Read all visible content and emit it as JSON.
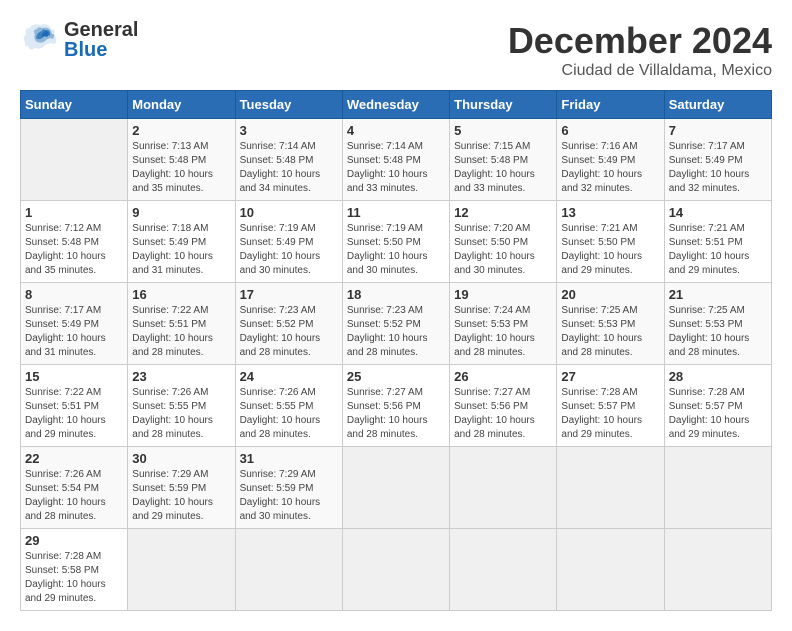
{
  "header": {
    "logo_general": "General",
    "logo_blue": "Blue",
    "title": "December 2024",
    "subtitle": "Ciudad de Villaldama, Mexico"
  },
  "calendar": {
    "days_of_week": [
      "Sunday",
      "Monday",
      "Tuesday",
      "Wednesday",
      "Thursday",
      "Friday",
      "Saturday"
    ],
    "weeks": [
      [
        {
          "day": "",
          "info": ""
        },
        {
          "day": "2",
          "info": "Sunrise: 7:13 AM\nSunset: 5:48 PM\nDaylight: 10 hours\nand 35 minutes."
        },
        {
          "day": "3",
          "info": "Sunrise: 7:14 AM\nSunset: 5:48 PM\nDaylight: 10 hours\nand 34 minutes."
        },
        {
          "day": "4",
          "info": "Sunrise: 7:14 AM\nSunset: 5:48 PM\nDaylight: 10 hours\nand 33 minutes."
        },
        {
          "day": "5",
          "info": "Sunrise: 7:15 AM\nSunset: 5:48 PM\nDaylight: 10 hours\nand 33 minutes."
        },
        {
          "day": "6",
          "info": "Sunrise: 7:16 AM\nSunset: 5:49 PM\nDaylight: 10 hours\nand 32 minutes."
        },
        {
          "day": "7",
          "info": "Sunrise: 7:17 AM\nSunset: 5:49 PM\nDaylight: 10 hours\nand 32 minutes."
        }
      ],
      [
        {
          "day": "1",
          "info": "Sunrise: 7:12 AM\nSunset: 5:48 PM\nDaylight: 10 hours\nand 35 minutes."
        },
        {
          "day": "9",
          "info": "Sunrise: 7:18 AM\nSunset: 5:49 PM\nDaylight: 10 hours\nand 31 minutes."
        },
        {
          "day": "10",
          "info": "Sunrise: 7:19 AM\nSunset: 5:49 PM\nDaylight: 10 hours\nand 30 minutes."
        },
        {
          "day": "11",
          "info": "Sunrise: 7:19 AM\nSunset: 5:50 PM\nDaylight: 10 hours\nand 30 minutes."
        },
        {
          "day": "12",
          "info": "Sunrise: 7:20 AM\nSunset: 5:50 PM\nDaylight: 10 hours\nand 30 minutes."
        },
        {
          "day": "13",
          "info": "Sunrise: 7:21 AM\nSunset: 5:50 PM\nDaylight: 10 hours\nand 29 minutes."
        },
        {
          "day": "14",
          "info": "Sunrise: 7:21 AM\nSunset: 5:51 PM\nDaylight: 10 hours\nand 29 minutes."
        }
      ],
      [
        {
          "day": "8",
          "info": "Sunrise: 7:17 AM\nSunset: 5:49 PM\nDaylight: 10 hours\nand 31 minutes."
        },
        {
          "day": "16",
          "info": "Sunrise: 7:22 AM\nSunset: 5:51 PM\nDaylight: 10 hours\nand 28 minutes."
        },
        {
          "day": "17",
          "info": "Sunrise: 7:23 AM\nSunset: 5:52 PM\nDaylight: 10 hours\nand 28 minutes."
        },
        {
          "day": "18",
          "info": "Sunrise: 7:23 AM\nSunset: 5:52 PM\nDaylight: 10 hours\nand 28 minutes."
        },
        {
          "day": "19",
          "info": "Sunrise: 7:24 AM\nSunset: 5:53 PM\nDaylight: 10 hours\nand 28 minutes."
        },
        {
          "day": "20",
          "info": "Sunrise: 7:25 AM\nSunset: 5:53 PM\nDaylight: 10 hours\nand 28 minutes."
        },
        {
          "day": "21",
          "info": "Sunrise: 7:25 AM\nSunset: 5:53 PM\nDaylight: 10 hours\nand 28 minutes."
        }
      ],
      [
        {
          "day": "15",
          "info": "Sunrise: 7:22 AM\nSunset: 5:51 PM\nDaylight: 10 hours\nand 29 minutes."
        },
        {
          "day": "23",
          "info": "Sunrise: 7:26 AM\nSunset: 5:55 PM\nDaylight: 10 hours\nand 28 minutes."
        },
        {
          "day": "24",
          "info": "Sunrise: 7:26 AM\nSunset: 5:55 PM\nDaylight: 10 hours\nand 28 minutes."
        },
        {
          "day": "25",
          "info": "Sunrise: 7:27 AM\nSunset: 5:56 PM\nDaylight: 10 hours\nand 28 minutes."
        },
        {
          "day": "26",
          "info": "Sunrise: 7:27 AM\nSunset: 5:56 PM\nDaylight: 10 hours\nand 28 minutes."
        },
        {
          "day": "27",
          "info": "Sunrise: 7:28 AM\nSunset: 5:57 PM\nDaylight: 10 hours\nand 29 minutes."
        },
        {
          "day": "28",
          "info": "Sunrise: 7:28 AM\nSunset: 5:57 PM\nDaylight: 10 hours\nand 29 minutes."
        }
      ],
      [
        {
          "day": "22",
          "info": "Sunrise: 7:26 AM\nSunset: 5:54 PM\nDaylight: 10 hours\nand 28 minutes."
        },
        {
          "day": "30",
          "info": "Sunrise: 7:29 AM\nSunset: 5:59 PM\nDaylight: 10 hours\nand 29 minutes."
        },
        {
          "day": "31",
          "info": "Sunrise: 7:29 AM\nSunset: 5:59 PM\nDaylight: 10 hours\nand 30 minutes."
        },
        {
          "day": "",
          "info": ""
        },
        {
          "day": "",
          "info": ""
        },
        {
          "day": "",
          "info": ""
        },
        {
          "day": "",
          "info": ""
        }
      ],
      [
        {
          "day": "29",
          "info": "Sunrise: 7:28 AM\nSunset: 5:58 PM\nDaylight: 10 hours\nand 29 minutes."
        },
        {
          "day": "",
          "info": ""
        },
        {
          "day": "",
          "info": ""
        },
        {
          "day": "",
          "info": ""
        },
        {
          "day": "",
          "info": ""
        },
        {
          "day": "",
          "info": ""
        },
        {
          "day": "",
          "info": ""
        }
      ]
    ],
    "proper_weeks": [
      [
        {
          "day": "1",
          "info": "Sunrise: 7:12 AM\nSunset: 5:48 PM\nDaylight: 10 hours\nand 35 minutes.",
          "empty": false
        },
        {
          "day": "2",
          "info": "Sunrise: 7:13 AM\nSunset: 5:48 PM\nDaylight: 10 hours\nand 35 minutes.",
          "empty": false
        },
        {
          "day": "3",
          "info": "Sunrise: 7:14 AM\nSunset: 5:48 PM\nDaylight: 10 hours\nand 34 minutes.",
          "empty": false
        },
        {
          "day": "4",
          "info": "Sunrise: 7:14 AM\nSunset: 5:48 PM\nDaylight: 10 hours\nand 33 minutes.",
          "empty": false
        },
        {
          "day": "5",
          "info": "Sunrise: 7:15 AM\nSunset: 5:48 PM\nDaylight: 10 hours\nand 33 minutes.",
          "empty": false
        },
        {
          "day": "6",
          "info": "Sunrise: 7:16 AM\nSunset: 5:49 PM\nDaylight: 10 hours\nand 32 minutes.",
          "empty": false
        },
        {
          "day": "7",
          "info": "Sunrise: 7:17 AM\nSunset: 5:49 PM\nDaylight: 10 hours\nand 32 minutes.",
          "empty": false
        }
      ]
    ]
  }
}
